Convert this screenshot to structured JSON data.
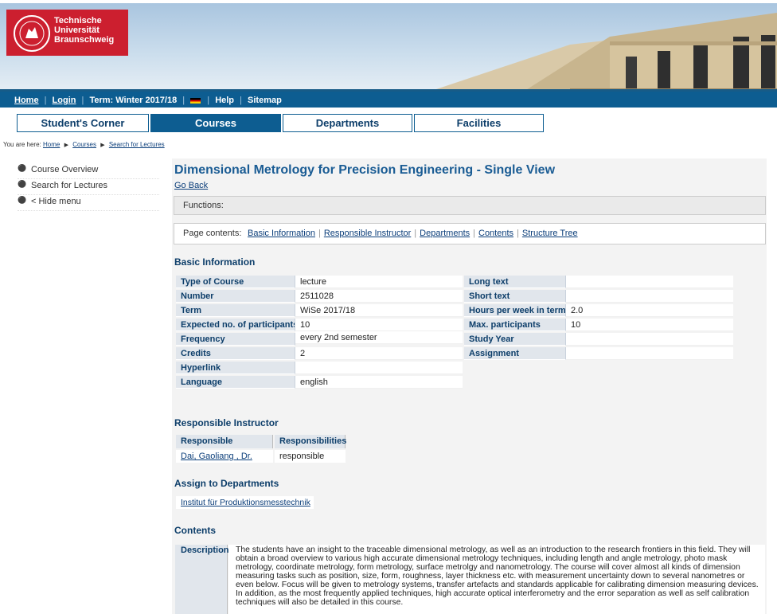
{
  "header": {
    "logo_lines": [
      "Technische",
      "Universität",
      "Braunschweig"
    ]
  },
  "topnav": {
    "home": "Home",
    "login": "Login",
    "term": "Term: Winter 2017/18",
    "help": "Help",
    "sitemap": "Sitemap",
    "sep": "|"
  },
  "tabs": [
    "Student's Corner",
    "Courses",
    "Departments",
    "Facilities"
  ],
  "breadcrumb": {
    "prefix": "You are here:",
    "items": [
      "Home",
      "Courses",
      "Search for Lectures"
    ]
  },
  "sidebar": {
    "items": [
      "Course Overview",
      "Search for Lectures",
      "< Hide menu"
    ]
  },
  "main": {
    "title": "Dimensional Metrology for Precision Engineering - Single View",
    "go_back": "Go Back",
    "functions_label": "Functions:",
    "page_contents_label": "Page contents:",
    "page_contents_links": [
      "Basic Information",
      "Responsible Instructor",
      "Departments",
      "Contents",
      "Structure Tree"
    ]
  },
  "basic_info": {
    "heading": "Basic Information",
    "left": [
      {
        "label": "Type of Course",
        "value": "lecture"
      },
      {
        "label": "Number",
        "value": "2511028"
      },
      {
        "label": "Term",
        "value": "WiSe 2017/18"
      },
      {
        "label": "Expected no. of participants",
        "value": "10"
      },
      {
        "label": "Frequency",
        "value": "every 2nd semester"
      },
      {
        "label": "Credits",
        "value": "2"
      },
      {
        "label": "Hyperlink",
        "value": ""
      },
      {
        "label": "Language",
        "value": "english"
      }
    ],
    "right": [
      {
        "label": "Long text",
        "value": ""
      },
      {
        "label": "Short text",
        "value": ""
      },
      {
        "label": "Hours per week in term",
        "value": "2.0"
      },
      {
        "label": "Max. participants",
        "value": "10"
      },
      {
        "label": "Study Year",
        "value": ""
      },
      {
        "label": "Assignment",
        "value": ""
      }
    ]
  },
  "instructor": {
    "heading": "Responsible Instructor",
    "col1": "Responsible Instructor",
    "col2": "Responsibilities",
    "name": "Dai, Gaoliang , Dr.",
    "role": "responsible"
  },
  "departments": {
    "heading": "Assign to Departments",
    "item": "Institut für Produktionsmesstechnik"
  },
  "contents": {
    "heading": "Contents",
    "desc_label": "Description",
    "desc_text": "The students have an insight to the traceable dimensional metrology, as well as an introduction to the research frontiers in this field. They will obtain a broad overview to various high accurate dimensional metrology techniques, including length and angle metrology, photo mask metrology, coordinate metrology, form metrology, surface metrolgy and nanometrology. The course will cover almost all kinds of dimension measuring tasks such as position, size, form, roughness, layer thickness etc. with measurement uncertainty down to several nanometres or even below. Focus will be given to metrology systems, transfer artefacts and standards applicable for calibrating dimension measuring devices. In addition, as the most frequently applied techniques, high accurate optical interferometry and the error separation as well as self calibration techniques will also be detailed in this course."
  },
  "colors": {
    "brand_red": "#cc1f2f",
    "nav_blue": "#0d5d91",
    "title_blue": "#1a5c94"
  }
}
